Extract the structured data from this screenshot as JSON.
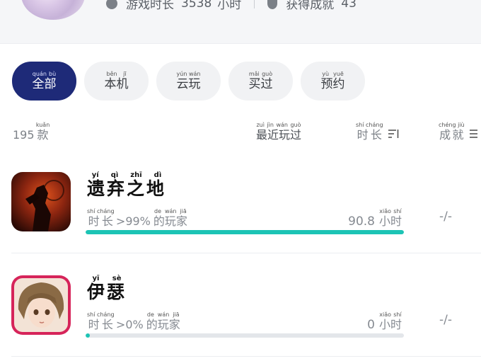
{
  "profile": {
    "play_time_label": "游戏时长",
    "play_time_value": "3538",
    "play_time_unit": "小时",
    "achievements_label": "获得成就",
    "achievements_value": "43"
  },
  "filters": [
    {
      "pinyin": "quán bù",
      "label": "全部",
      "active": true
    },
    {
      "pinyin": "běn jī",
      "label": "本机",
      "active": false
    },
    {
      "pinyin": "yún wán",
      "label": "云玩",
      "active": false
    },
    {
      "pinyin": "mǎi guò",
      "label": "买过",
      "active": false
    },
    {
      "pinyin": "yù yuē",
      "label": "预约",
      "active": false
    }
  ],
  "list_header": {
    "count": "195",
    "count_unit": "款",
    "count_unit_pinyin": "kuǎn",
    "sort_recent": "最近玩过",
    "sort_recent_pinyin": "zuì jìn wán guò",
    "sort_duration": "时长",
    "sort_duration_pinyin": "shí cháng",
    "sort_icon": "sort-descending-icon",
    "achievements": "成就",
    "achievements_pinyin": "chéng jiù"
  },
  "games": [
    {
      "title": "遗弃之地",
      "title_pinyin": "yí qì zhī dì",
      "percent_prefix": "时长",
      "percent_prefix_pinyin": "shí cháng",
      "percent_text": ">99%",
      "percent_suffix": "的玩家",
      "percent_suffix_pinyin": "de wán jiā",
      "hours": "90.8",
      "hours_unit": "小时",
      "hours_unit_pinyin": "xiǎo shí",
      "achievements": "-/-",
      "progress": 1.0,
      "icon": "dark-warrior-icon"
    },
    {
      "title": "伊瑟",
      "title_pinyin": "yī sè",
      "percent_prefix": "时长",
      "percent_prefix_pinyin": "shí cháng",
      "percent_text": ">0%",
      "percent_suffix": "的玩家",
      "percent_suffix_pinyin": "de wán jiā",
      "hours": "0",
      "hours_unit": "小时",
      "hours_unit_pinyin": "xiǎo shí",
      "achievements": "-/-",
      "progress": 0.01,
      "icon": "anime-girl-portrait-icon"
    }
  ],
  "colors": {
    "accent": "#1e2a78",
    "progress": "#1cc4b5",
    "track": "#e3e6ea"
  }
}
